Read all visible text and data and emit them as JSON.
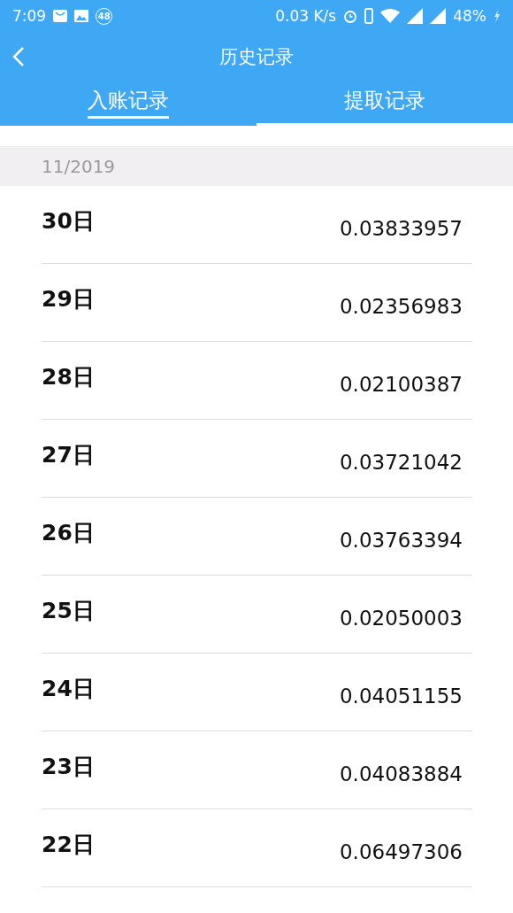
{
  "status_bar": {
    "time": "7:09",
    "badge": "48",
    "speed": "0.03 K/s",
    "battery": "48%"
  },
  "header": {
    "title": "历史记录"
  },
  "tabs": [
    {
      "label": "入账记录",
      "selected": true
    },
    {
      "label": "提取记录",
      "selected": false
    }
  ],
  "month": "11/2019",
  "rows": [
    {
      "day": "30日",
      "amount": "0.03833957"
    },
    {
      "day": "29日",
      "amount": "0.02356983"
    },
    {
      "day": "28日",
      "amount": "0.02100387"
    },
    {
      "day": "27日",
      "amount": "0.03721042"
    },
    {
      "day": "26日",
      "amount": "0.03763394"
    },
    {
      "day": "25日",
      "amount": "0.02050003"
    },
    {
      "day": "24日",
      "amount": "0.04051155"
    },
    {
      "day": "23日",
      "amount": "0.04083884"
    },
    {
      "day": "22日",
      "amount": "0.06497306"
    }
  ]
}
